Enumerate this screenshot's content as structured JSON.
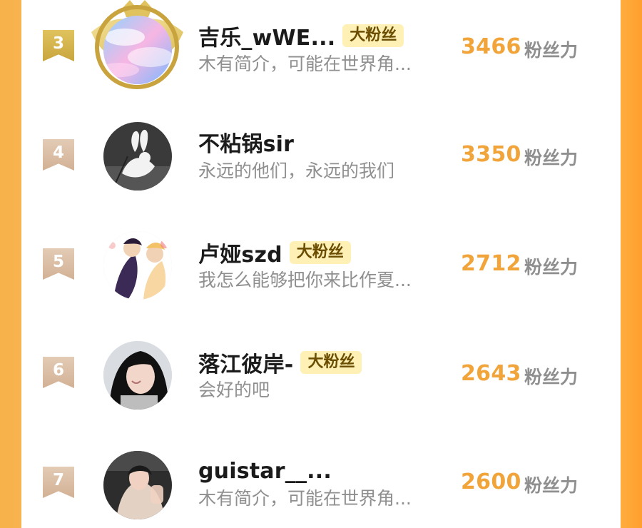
{
  "items": [
    {
      "rank": "3",
      "name": "吉乐_wWE...",
      "badge": "大粉丝",
      "bio": "木有简介，可能在世界角...",
      "score": "3466",
      "unit": "粉丝力"
    },
    {
      "rank": "4",
      "name": "不粘锅sir",
      "badge": "",
      "bio": "永远的他们，永远的我们",
      "score": "3350",
      "unit": "粉丝力"
    },
    {
      "rank": "5",
      "name": "卢娅szd",
      "badge": "大粉丝",
      "bio": "我怎么能够把你来比作夏...",
      "score": "2712",
      "unit": "粉丝力"
    },
    {
      "rank": "6",
      "name": "落江彼岸-",
      "badge": "大粉丝",
      "bio": "会好的吧",
      "score": "2643",
      "unit": "粉丝力"
    },
    {
      "rank": "7",
      "name": "guistar__...",
      "badge": "",
      "bio": "木有简介，可能在世界角...",
      "score": "2600",
      "unit": "粉丝力"
    }
  ]
}
